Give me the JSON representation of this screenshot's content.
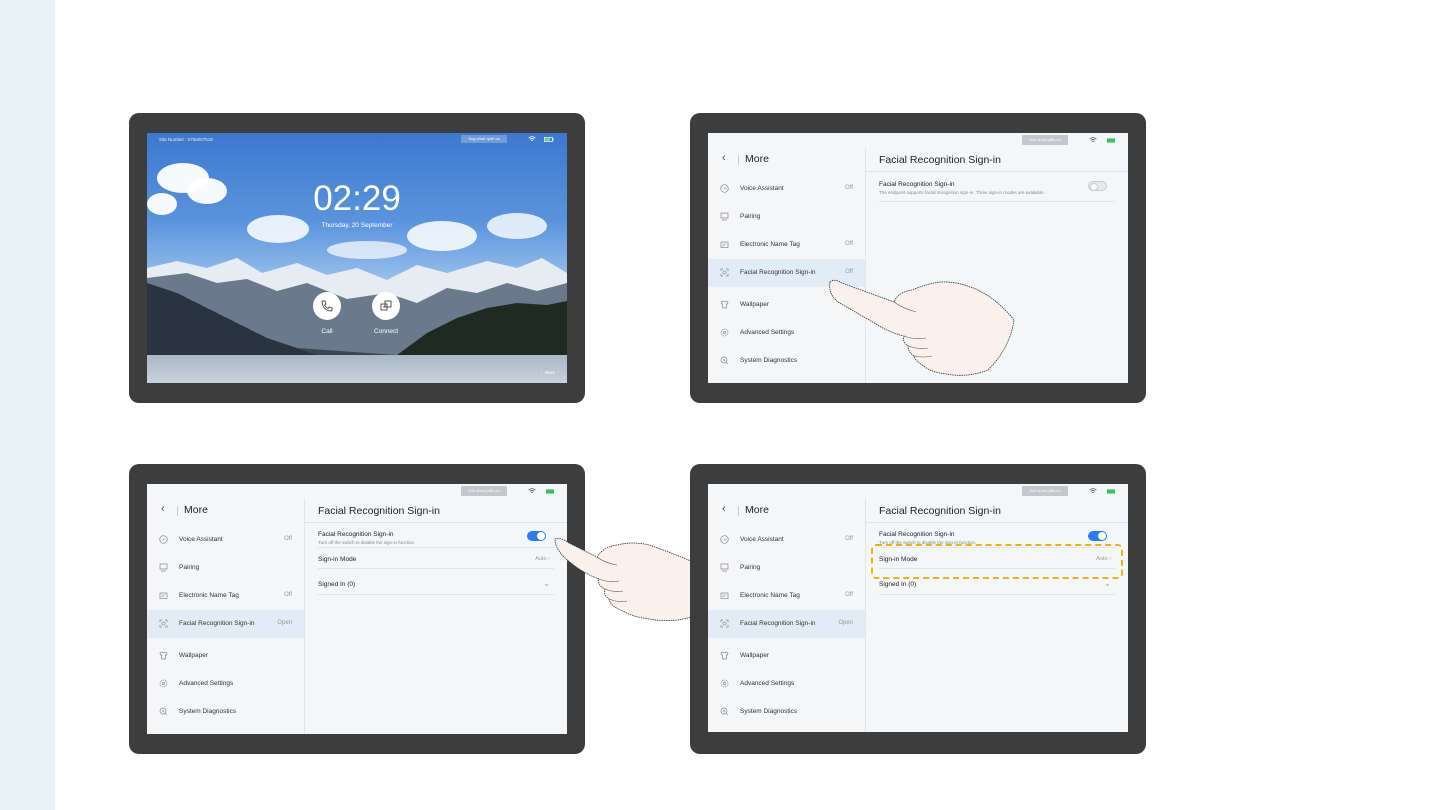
{
  "home": {
    "site_number": "Site Number : 0755007518",
    "qr_label": "Sog short rpeil ca",
    "time": "02:29",
    "date": "Thursday, 20 September",
    "call_label": "Call",
    "connect_label": "Connect",
    "more_label": "More"
  },
  "settings": {
    "qr_label": "Sob short piills co",
    "back_title": "More",
    "main_title": "Facial Recognition Sign-in",
    "sidebar_items": [
      {
        "label": "Voice Assistant",
        "icon": "voice-assistant-icon"
      },
      {
        "label": "Pairing",
        "icon": "pairing-icon"
      },
      {
        "label": "Electronic Name Tag",
        "icon": "name-tag-icon"
      },
      {
        "label": "Facial Recognition Sign-in",
        "icon": "face-recognition-icon"
      },
      {
        "label": "Wallpaper",
        "icon": "wallpaper-icon"
      },
      {
        "label": "Advanced Settings",
        "icon": "gear-icon"
      },
      {
        "label": "System Diagnostics",
        "icon": "diagnostics-icon"
      }
    ],
    "values_off": {
      "voice_assistant": "Off",
      "electronic_name_tag": "Off",
      "facial_recognition": "Off"
    },
    "values_on": {
      "voice_assistant": "Off",
      "electronic_name_tag": "Off",
      "facial_recognition": "Open"
    },
    "toggle_row_title": "Facial Recognition Sign-in",
    "toggle_row_desc_off": "The endpoint supports facial recognition sign-in. Three sign-in modes are available.",
    "toggle_row_desc_on": "Turn off the switch to disable the sign-in function.",
    "sign_in_mode_label": "Sign-in Mode",
    "sign_in_mode_value": "Auto",
    "signed_in_label": "Signed In  (0)"
  },
  "colors": {
    "accent_blue": "#2a7df0",
    "highlight_yellow": "#f0b400",
    "bezel": "#3d3d3d"
  }
}
